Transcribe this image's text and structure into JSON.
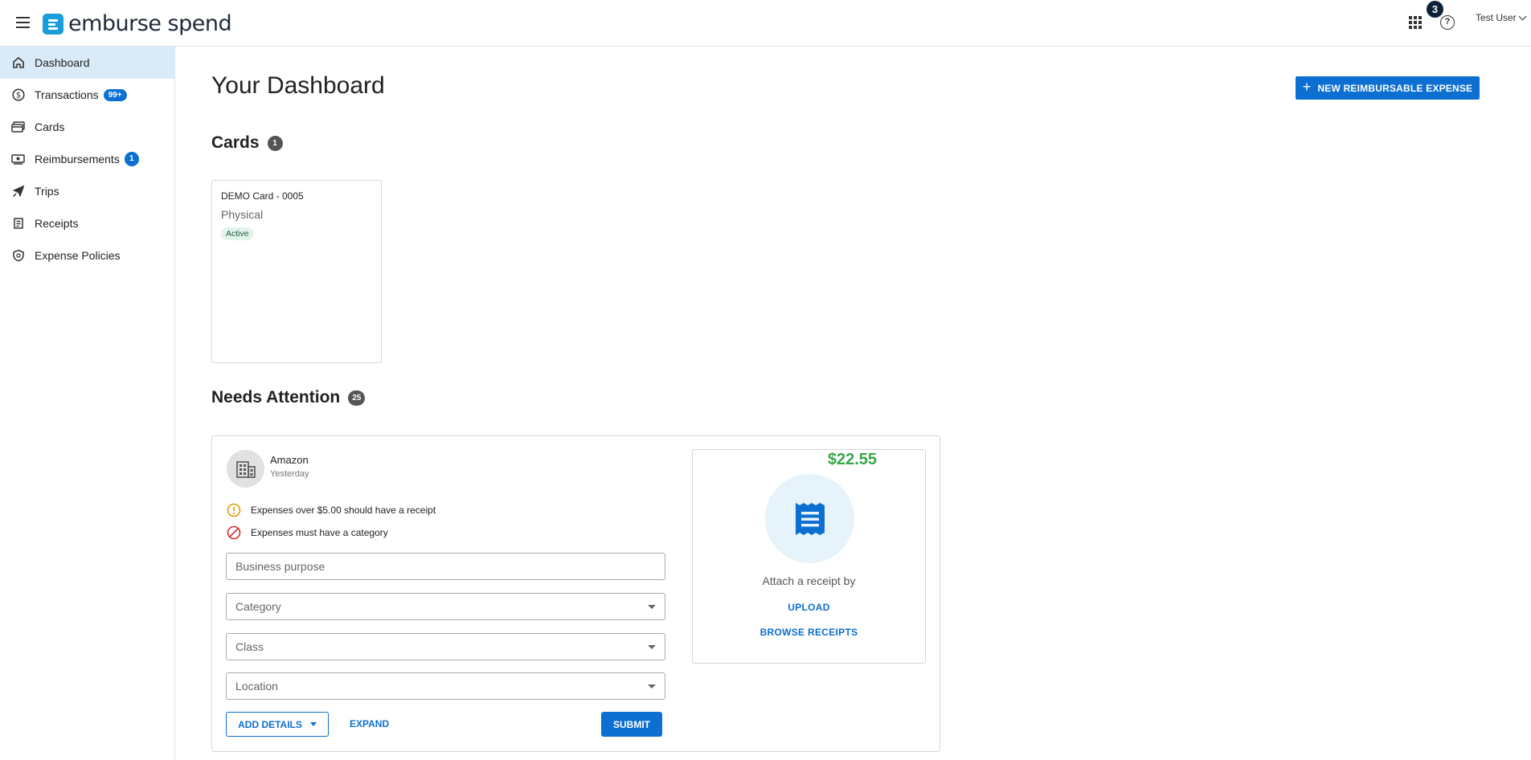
{
  "header": {
    "brand": "emburse spend",
    "notification_count": "3",
    "user_name": "Test User"
  },
  "sidebar": {
    "items": [
      {
        "label": "Dashboard",
        "icon": "home-icon",
        "active": true
      },
      {
        "label": "Transactions",
        "icon": "dollar-circle-icon",
        "badge": "99+"
      },
      {
        "label": "Cards",
        "icon": "cards-icon"
      },
      {
        "label": "Reimbursements",
        "icon": "cash-icon",
        "badge": "1"
      },
      {
        "label": "Trips",
        "icon": "airplane-icon"
      },
      {
        "label": "Receipts",
        "icon": "receipt-icon"
      },
      {
        "label": "Expense Policies",
        "icon": "shield-icon"
      }
    ]
  },
  "main": {
    "title": "Your Dashboard",
    "new_expense_label": "NEW REIMBURSABLE EXPENSE",
    "cards_section": {
      "title": "Cards",
      "count": "1",
      "cards": [
        {
          "name": "DEMO Card - 0005",
          "type": "Physical",
          "status": "Active"
        }
      ]
    },
    "attention_section": {
      "title": "Needs Attention",
      "count": "25",
      "item": {
        "merchant": "Amazon",
        "date": "Yesterday",
        "amount": "$22.55",
        "warnings": [
          "Expenses over $5.00 should have a receipt",
          "Expenses must have a category"
        ],
        "business_purpose_placeholder": "Business purpose",
        "category_placeholder": "Category",
        "class_placeholder": "Class",
        "location_placeholder": "Location",
        "add_details_label": "ADD DETAILS",
        "expand_label": "EXPAND",
        "submit_label": "SUBMIT",
        "attach_text": "Attach a receipt by",
        "upload_label": "UPLOAD",
        "browse_label": "BROWSE RECEIPTS"
      }
    }
  },
  "colors": {
    "accent": "#0c6fd1",
    "brand": "#1a9dd9",
    "amount_green": "#3aa64a",
    "active_nav": "#d9ebf8"
  }
}
